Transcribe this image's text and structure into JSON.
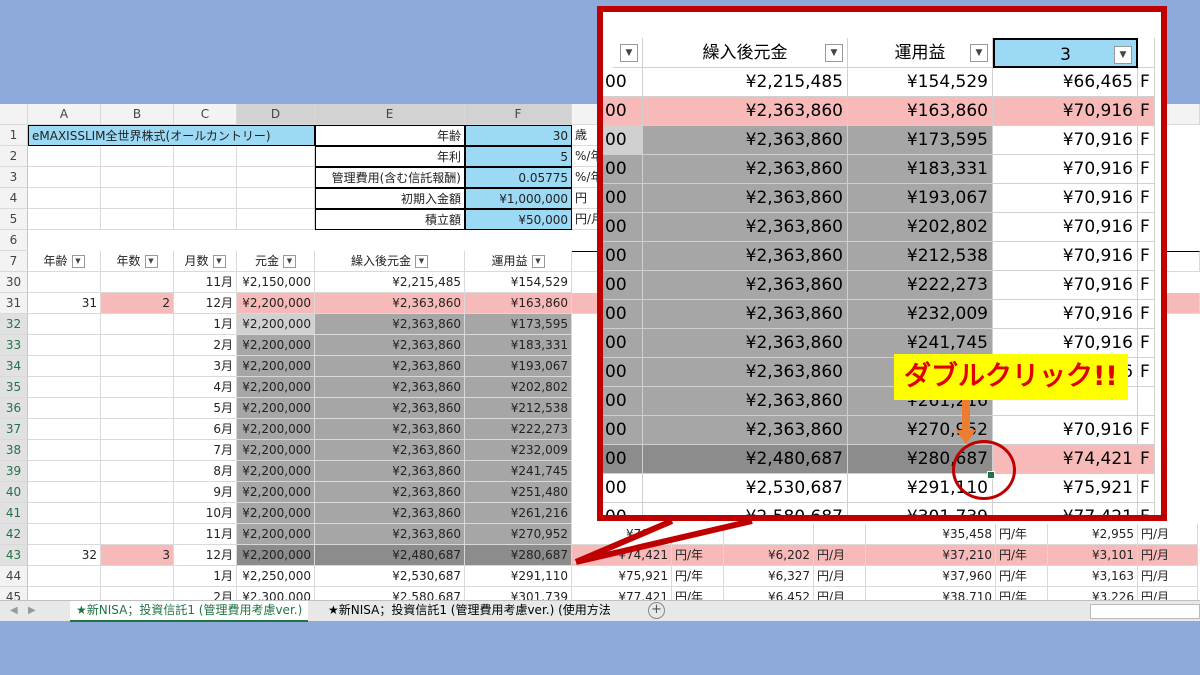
{
  "columns": [
    "A",
    "B",
    "C",
    "D",
    "E",
    "F"
  ],
  "params": {
    "fund_name": "eMAXISSLIM全世界株式(オールカントリー)",
    "rows": [
      {
        "label": "年齢",
        "value": "30",
        "unit": "歳"
      },
      {
        "label": "年利",
        "value": "5",
        "unit": "%/年"
      },
      {
        "label": "管理費用(含む信託報酬)",
        "value": "0.05775",
        "unit": "%/年"
      },
      {
        "label": "初期入金額",
        "value": "¥1,000,000",
        "unit": "円"
      },
      {
        "label": "積立額",
        "value": "¥50,000",
        "unit": "円/月"
      }
    ]
  },
  "headers": [
    "年齢",
    "年数",
    "月数",
    "元金",
    "繰入後元金",
    "運用益"
  ],
  "row_numbers": [
    "1",
    "2",
    "3",
    "4",
    "5",
    "6",
    "7",
    "30",
    "31",
    "32",
    "33",
    "34",
    "35",
    "36",
    "37",
    "38",
    "39",
    "40",
    "41",
    "42",
    "43",
    "44",
    "45"
  ],
  "rows": [
    {
      "age": "",
      "years": "",
      "month": "11月",
      "principal": "¥2,150,000",
      "after": "¥2,215,485",
      "profit": "¥154,529"
    },
    {
      "age": "31",
      "years": "2",
      "month": "12月",
      "principal": "¥2,200,000",
      "after": "¥2,363,860",
      "profit": "¥163,860"
    },
    {
      "age": "",
      "years": "",
      "month": "1月",
      "principal": "¥2,200,000",
      "after": "¥2,363,860",
      "profit": "¥173,595"
    },
    {
      "age": "",
      "years": "",
      "month": "2月",
      "principal": "¥2,200,000",
      "after": "¥2,363,860",
      "profit": "¥183,331"
    },
    {
      "age": "",
      "years": "",
      "month": "3月",
      "principal": "¥2,200,000",
      "after": "¥2,363,860",
      "profit": "¥193,067"
    },
    {
      "age": "",
      "years": "",
      "month": "4月",
      "principal": "¥2,200,000",
      "after": "¥2,363,860",
      "profit": "¥202,802"
    },
    {
      "age": "",
      "years": "",
      "month": "5月",
      "principal": "¥2,200,000",
      "after": "¥2,363,860",
      "profit": "¥212,538"
    },
    {
      "age": "",
      "years": "",
      "month": "6月",
      "principal": "¥2,200,000",
      "after": "¥2,363,860",
      "profit": "¥222,273"
    },
    {
      "age": "",
      "years": "",
      "month": "7月",
      "principal": "¥2,200,000",
      "after": "¥2,363,860",
      "profit": "¥232,009"
    },
    {
      "age": "",
      "years": "",
      "month": "8月",
      "principal": "¥2,200,000",
      "after": "¥2,363,860",
      "profit": "¥241,745"
    },
    {
      "age": "",
      "years": "",
      "month": "9月",
      "principal": "¥2,200,000",
      "after": "¥2,363,860",
      "profit": "¥251,480"
    },
    {
      "age": "",
      "years": "",
      "month": "10月",
      "principal": "¥2,200,000",
      "after": "¥2,363,860",
      "profit": "¥261,216"
    },
    {
      "age": "",
      "years": "",
      "month": "11月",
      "principal": "¥2,200,000",
      "after": "¥2,363,860",
      "profit": "¥270,952"
    },
    {
      "age": "32",
      "years": "3",
      "month": "12月",
      "principal": "¥2,200,000",
      "after": "¥2,480,687",
      "profit": "¥280,687"
    },
    {
      "age": "",
      "years": "",
      "month": "1月",
      "principal": "¥2,250,000",
      "after": "¥2,530,687",
      "profit": "¥291,110"
    },
    {
      "age": "",
      "years": "",
      "month": "2月",
      "principal": "¥2,300,000",
      "after": "¥2,580,687",
      "profit": "¥301,739"
    }
  ],
  "right_rows": [
    {
      "annual": "¥75,921",
      "u1": "円/年",
      "monthly": "¥6,327",
      "u2": "円/月",
      "annual2": "¥37,960",
      "u3": "円/年",
      "monthly2": "¥3,163",
      "u4": "円/月"
    },
    {
      "annual": "¥77,421",
      "u1": "円/年",
      "monthly": "¥6,452",
      "u2": "円/月",
      "annual2": "¥38,710",
      "u3": "円/年",
      "monthly2": "¥3,226",
      "u4": "円/月"
    }
  ],
  "right_partial": [
    {
      "annual": "¥70,91",
      "u1": "",
      "monthly": "",
      "u2": "",
      "annual2": "¥35,458",
      "u3": "円/年",
      "monthly2": "¥2,955",
      "u4": "円/月"
    },
    {
      "annual": "¥74,421",
      "u1": "円/年",
      "monthly": "¥6,202",
      "u2": "円/月",
      "annual2": "¥37,210",
      "u3": "円/年",
      "monthly2": "¥3,101",
      "u4": "円/月"
    }
  ],
  "zoom": {
    "headers": [
      "繰入後元金",
      "運用益",
      "3"
    ],
    "rows": [
      {
        "a": "00",
        "after": "¥2,215,485",
        "profit": "¥154,529",
        "g": "¥66,465",
        "h": "F"
      },
      {
        "a": "00",
        "after": "¥2,363,860",
        "profit": "¥163,860",
        "g": "¥70,916",
        "h": "F"
      },
      {
        "a": "00",
        "after": "¥2,363,860",
        "profit": "¥173,595",
        "g": "¥70,916",
        "h": "F"
      },
      {
        "a": "00",
        "after": "¥2,363,860",
        "profit": "¥183,331",
        "g": "¥70,916",
        "h": "F"
      },
      {
        "a": "00",
        "after": "¥2,363,860",
        "profit": "¥193,067",
        "g": "¥70,916",
        "h": "F"
      },
      {
        "a": "00",
        "after": "¥2,363,860",
        "profit": "¥202,802",
        "g": "¥70,916",
        "h": "F"
      },
      {
        "a": "00",
        "after": "¥2,363,860",
        "profit": "¥212,538",
        "g": "¥70,916",
        "h": "F"
      },
      {
        "a": "00",
        "after": "¥2,363,860",
        "profit": "¥222,273",
        "g": "¥70,916",
        "h": "F"
      },
      {
        "a": "00",
        "after": "¥2,363,860",
        "profit": "¥232,009",
        "g": "¥70,916",
        "h": "F"
      },
      {
        "a": "00",
        "after": "¥2,363,860",
        "profit": "¥241,745",
        "g": "¥70,916",
        "h": "F"
      },
      {
        "a": "00",
        "after": "¥2,363,860",
        "profit": "¥251,480",
        "g": "¥70,916",
        "h": "F"
      },
      {
        "a": "00",
        "after": "¥2,363,860",
        "profit": "¥261,216",
        "g": "",
        "h": ""
      },
      {
        "a": "00",
        "after": "¥2,363,860",
        "profit": "¥270,952",
        "g": "¥70,916",
        "h": "F"
      },
      {
        "a": "00",
        "after": "¥2,480,687",
        "profit": "¥280,687",
        "g": "¥74,421",
        "h": "F"
      },
      {
        "a": "00",
        "after": "¥2,530,687",
        "profit": "¥291,110",
        "g": "¥75,921",
        "h": "F"
      },
      {
        "a": "00",
        "after": "¥2,580,687",
        "profit": "¥301,739",
        "g": "¥77,421",
        "h": "F"
      }
    ]
  },
  "callout": "ダブルクリック!!",
  "tabs": [
    "★新NISA；投資信託1 (管理費用考慮ver.)",
    "★新NISA；投資信託1 (管理費用考慮ver.) (使用方法"
  ],
  "colors": {
    "background": "#8eaadb",
    "blue_cell": "#9bd9f4",
    "pink_cell": "#f8b9b9",
    "selected_gray": "#a6a6a6",
    "accent_red": "#c00000",
    "callout_yellow": "#ffff00",
    "arrow_orange": "#ed7d31",
    "excel_green": "#217346"
  }
}
